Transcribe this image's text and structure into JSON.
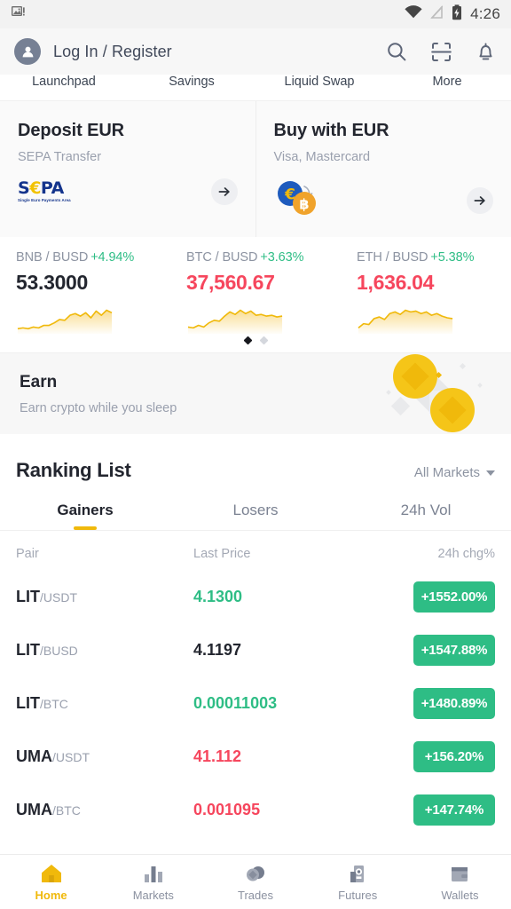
{
  "statusbar": {
    "notification_icon": "image-notification-icon",
    "wifi_icon": "wifi-icon",
    "signal_icon": "signal-off-icon",
    "battery_icon": "battery-charging-icon",
    "time": "4:26"
  },
  "header": {
    "avatar_icon": "person-icon",
    "login_label": "Log In / Register",
    "search_icon": "search-icon",
    "scan_icon": "scan-qr-icon",
    "bell_icon": "bell-icon"
  },
  "quicklinks": {
    "items": [
      {
        "label": "Launchpad"
      },
      {
        "label": "Savings"
      },
      {
        "label": "Liquid Swap"
      },
      {
        "label": "More"
      }
    ]
  },
  "cards": [
    {
      "title": "Deposit EUR",
      "subtitle": "SEPA Transfer",
      "logo": "sepa-logo",
      "logo_text": {
        "s": "S",
        "euro": "€",
        "pa": "PA",
        "sub": "Single Euro Payments Area"
      },
      "arrow_icon": "arrow-right-icon"
    },
    {
      "title": "Buy with EUR",
      "subtitle": "Visa, Mastercard",
      "logo": "euro-to-bitcoin-icon",
      "arrow_icon": "arrow-right-icon"
    }
  ],
  "tickers": [
    {
      "pair": "BNB / BUSD",
      "change": "+4.94%",
      "change_color": "#2ebd85",
      "price": "53.3000",
      "price_color": "#23262f",
      "spark": "2,32 8,31 14,32 20,30 26,31 32,28 38,28 44,25 50,21 56,22 62,16 68,14 74,17 80,13 86,19 92,11 98,16 104,10 110,13"
    },
    {
      "pair": "BTC / BUSD",
      "change": "+3.63%",
      "change_color": "#2ebd85",
      "price": "37,560.67",
      "price_color": "#f6465d",
      "spark": "2,30 8,31 14,28 20,30 26,25 32,22 38,23 44,17 50,12 56,15 62,10 68,14 74,11 80,16 86,15 92,17 98,16 104,18 110,17"
    },
    {
      "pair": "ETH / BUSD",
      "change": "+5.38%",
      "change_color": "#2ebd85",
      "price": "1,636.04",
      "price_color": "#f6465d",
      "spark": "2,31 8,26 14,27 20,20 26,18 32,21 38,14 44,12 50,15 56,10 62,12 68,11 74,14 80,12 86,16 92,14 98,17 104,19 110,20"
    }
  ],
  "carousel": {
    "active_index": 0,
    "total": 2
  },
  "earn": {
    "title": "Earn",
    "subtitle": "Earn crypto while you sleep",
    "art_icon": "coins-art-icon"
  },
  "ranking": {
    "title": "Ranking List",
    "filter_label": "All Markets",
    "filter_icon": "chevron-down-icon",
    "tabs": [
      {
        "label": "Gainers",
        "active": true
      },
      {
        "label": "Losers",
        "active": false
      },
      {
        "label": "24h Vol",
        "active": false
      }
    ],
    "columns": {
      "pair": "Pair",
      "price": "Last Price",
      "change": "24h chg%"
    },
    "rows": [
      {
        "base": "LIT",
        "quote": "/USDT",
        "price": "4.1300",
        "price_color": "#2ebd85",
        "change": "+1552.00%"
      },
      {
        "base": "LIT",
        "quote": "/BUSD",
        "price": "4.1197",
        "price_color": "#23262f",
        "change": "+1547.88%"
      },
      {
        "base": "LIT",
        "quote": "/BTC",
        "price": "0.00011003",
        "price_color": "#2ebd85",
        "change": "+1480.89%"
      },
      {
        "base": "UMA",
        "quote": "/USDT",
        "price": "41.112",
        "price_color": "#f6465d",
        "change": "+156.20%"
      },
      {
        "base": "UMA",
        "quote": "/BTC",
        "price": "0.001095",
        "price_color": "#f6465d",
        "change": "+147.74%"
      }
    ]
  },
  "bottomnav": {
    "items": [
      {
        "label": "Home",
        "icon": "home-icon",
        "active": true
      },
      {
        "label": "Markets",
        "icon": "bar-chart-icon",
        "active": false
      },
      {
        "label": "Trades",
        "icon": "trades-icon",
        "active": false
      },
      {
        "label": "Futures",
        "icon": "futures-icon",
        "active": false
      },
      {
        "label": "Wallets",
        "icon": "wallet-icon",
        "active": false
      }
    ]
  },
  "colors": {
    "brand_yellow": "#f0b90b",
    "up_green": "#2ebd85",
    "down_red": "#f6465d",
    "text_dark": "#23262f",
    "text_muted": "#8c93a1"
  }
}
